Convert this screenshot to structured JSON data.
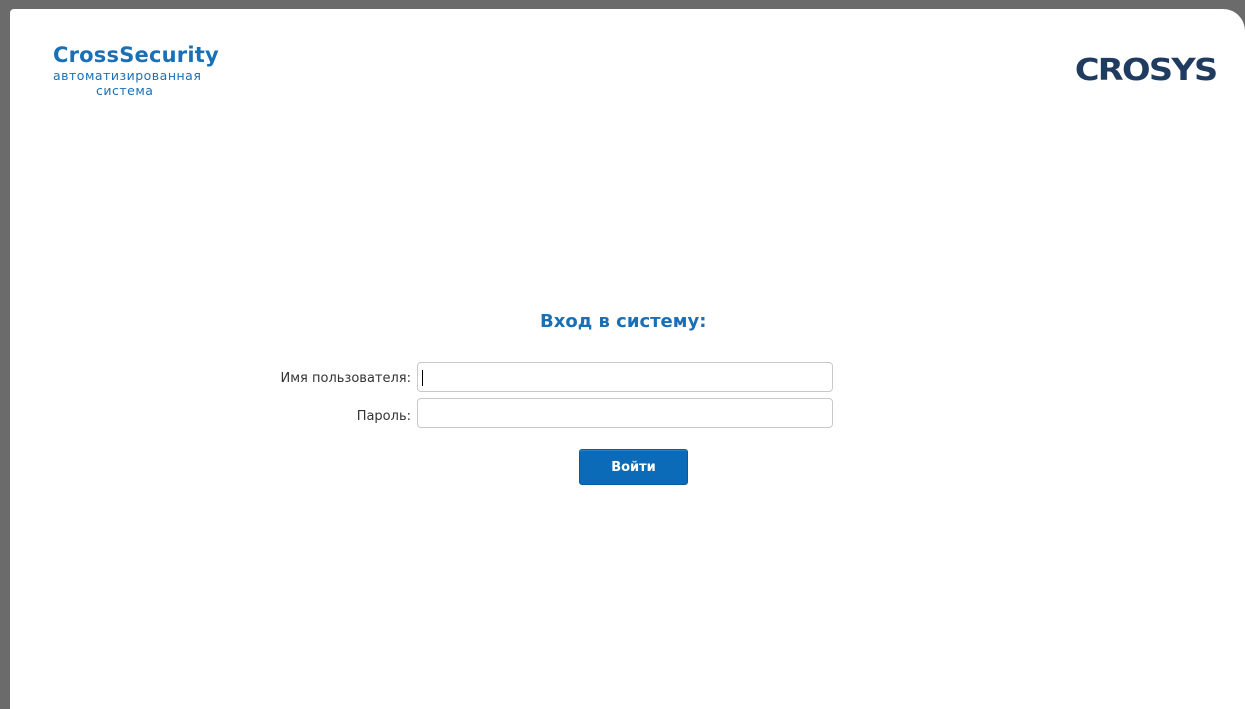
{
  "brand": {
    "title": "CrossSecurity",
    "subtitle_line1": "автоматизированная",
    "subtitle_line2": "система",
    "color": "#1a6fb5"
  },
  "logo": {
    "text": "CROSYS",
    "color": "#1f3b5f"
  },
  "login": {
    "title": "Вход в систему:",
    "username_label": "Имя пользователя:",
    "username_value": "",
    "password_label": "Пароль:",
    "password_value": "",
    "submit_label": "Войти",
    "button_color": "#0c6bb8"
  }
}
